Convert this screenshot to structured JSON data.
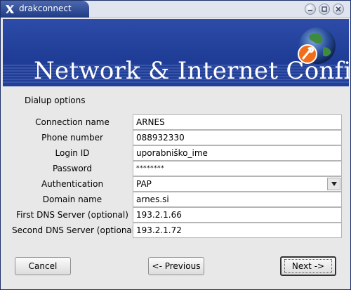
{
  "window": {
    "title": "drakconnect"
  },
  "banner": {
    "title": "Network & Internet Configuration"
  },
  "section": {
    "title": "Dialup options"
  },
  "fields": [
    {
      "label": "Connection name",
      "value": "ARNES"
    },
    {
      "label": "Phone number",
      "value": "088932330"
    },
    {
      "label": "Login ID",
      "value": "uporabniško_ime"
    },
    {
      "label": "Password",
      "value": "********"
    },
    {
      "label": "Authentication",
      "value": "PAP"
    },
    {
      "label": "Domain name",
      "value": "arnes.si"
    },
    {
      "label": "First DNS Server (optional)",
      "value": "193.2.1.66"
    },
    {
      "label": "Second DNS Server (optional)",
      "value": "193.2.1.72"
    }
  ],
  "buttons": {
    "cancel": "Cancel",
    "previous": "<- Previous",
    "next": "Next ->"
  },
  "colors": {
    "banner": "#213f97",
    "titlebar_accent": "#2c4a9a"
  },
  "icons": {
    "app": "x-logo-icon",
    "banner": "globe-wrench-icon"
  }
}
